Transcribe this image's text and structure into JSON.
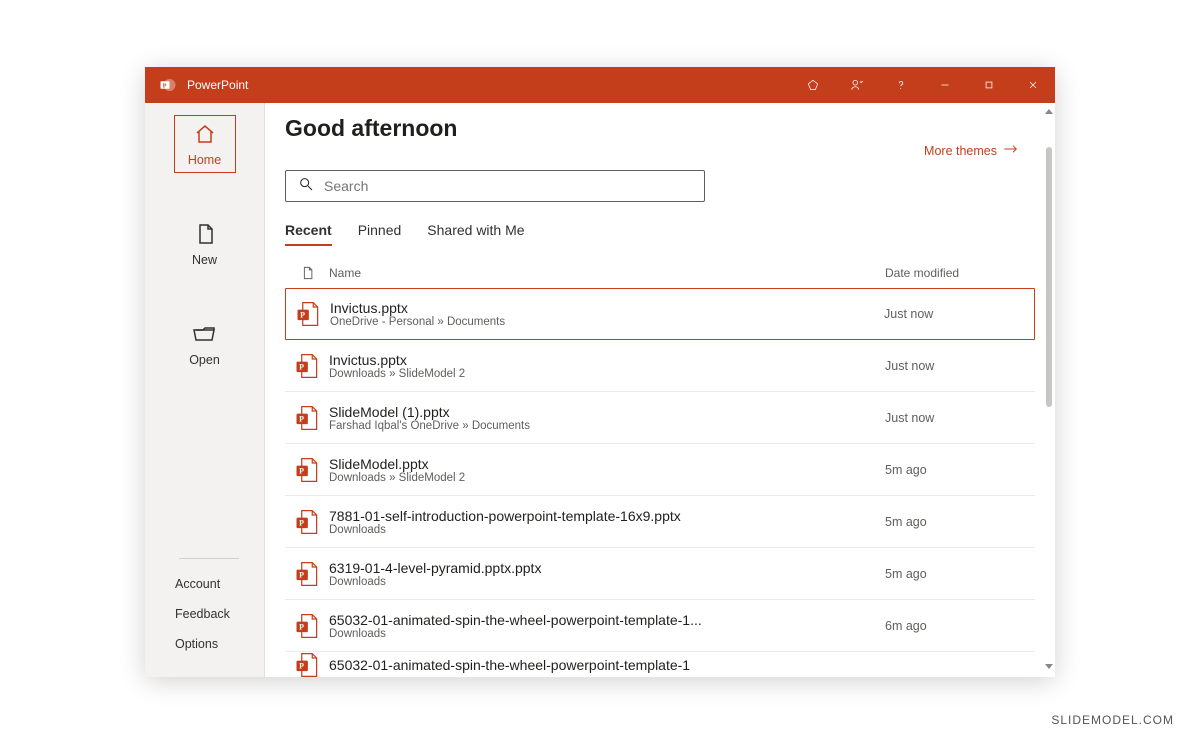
{
  "app": {
    "name": "PowerPoint"
  },
  "greeting": "Good afternoon",
  "moreThemes": "More themes",
  "search": {
    "placeholder": "Search"
  },
  "sidebar": {
    "home": "Home",
    "new": "New",
    "open": "Open",
    "account": "Account",
    "feedback": "Feedback",
    "options": "Options"
  },
  "tabs": {
    "recent": "Recent",
    "pinned": "Pinned",
    "shared": "Shared with Me"
  },
  "columns": {
    "name": "Name",
    "date": "Date modified"
  },
  "files": [
    {
      "name": "Invictus.pptx",
      "path": "OneDrive - Personal » Documents",
      "modified": "Just now",
      "highlight": true
    },
    {
      "name": "Invictus.pptx",
      "path": "Downloads » SlideModel 2",
      "modified": "Just now"
    },
    {
      "name": "SlideModel (1).pptx",
      "path": "Farshad Iqbal's OneDrive » Documents",
      "modified": "Just now"
    },
    {
      "name": "SlideModel.pptx",
      "path": "Downloads » SlideModel 2",
      "modified": "5m ago"
    },
    {
      "name": "7881-01-self-introduction-powerpoint-template-16x9.pptx",
      "path": "Downloads",
      "modified": "5m ago"
    },
    {
      "name": "6319-01-4-level-pyramid.pptx.pptx",
      "path": "Downloads",
      "modified": "5m ago"
    },
    {
      "name": "65032-01-animated-spin-the-wheel-powerpoint-template-1...",
      "path": "Downloads",
      "modified": "6m ago"
    },
    {
      "name": "65032-01-animated-spin-the-wheel-powerpoint-template-1",
      "path": "",
      "modified": "",
      "partial": true
    }
  ],
  "watermark": "SLIDEMODEL.COM"
}
